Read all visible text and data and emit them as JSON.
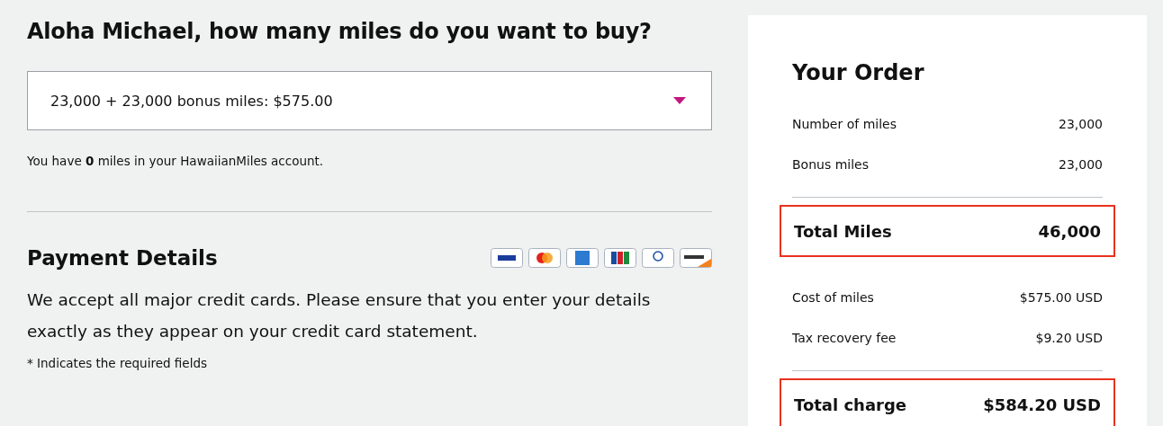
{
  "heading": "Aloha Michael, how many miles do you want to buy?",
  "miles_select": {
    "value": "23,000 + 23,000 bonus miles: $575.00"
  },
  "balance_note": "You have **0** miles in your HawaiianMiles account.",
  "payment": {
    "title": "Payment Details",
    "cards": [
      {
        "kind": "visa"
      },
      {
        "kind": "mastercard"
      },
      {
        "kind": "amex"
      },
      {
        "kind": "jcb"
      },
      {
        "kind": "diners"
      },
      {
        "kind": "discover"
      }
    ],
    "description": "We accept all major credit cards. Please ensure that you enter your details exactly as they appear on your credit card statement.",
    "required_note": "* Indicates the required fields"
  },
  "order": {
    "title": "Your Order",
    "groups": [
      {
        "rows": [
          {
            "label": "Number of miles",
            "value": "23,000"
          },
          {
            "label": "Bonus miles",
            "value": "23,000"
          }
        ],
        "total": {
          "label": "Total Miles",
          "value": "46,000",
          "highlighted": true
        }
      },
      {
        "rows": [
          {
            "label": "Cost of miles",
            "value": "$575.00 USD"
          },
          {
            "label": "Tax recovery fee",
            "value": "$9.20 USD"
          }
        ],
        "total": {
          "label": "Total charge",
          "value": "$584.20 USD",
          "highlighted": true
        }
      }
    ]
  }
}
